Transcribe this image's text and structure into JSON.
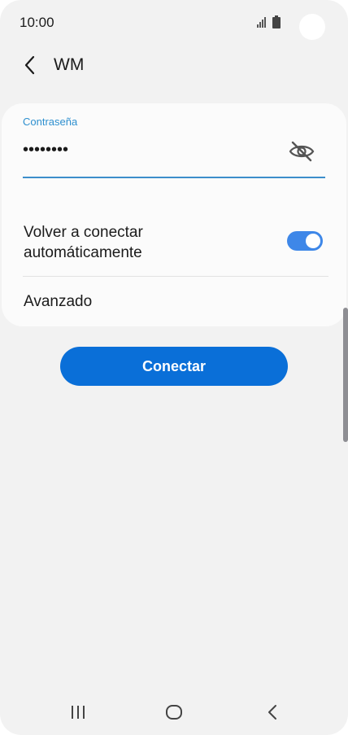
{
  "status_bar": {
    "time": "10:00",
    "icons": [
      "signal-icon",
      "battery-icon"
    ]
  },
  "header": {
    "back_icon": "chevron-left-icon",
    "title": "WM"
  },
  "form": {
    "password_label": "Contraseña",
    "password_value": "••••••••",
    "visibility_icon": "eye-off-icon",
    "reconnect_label": "Volver a conectar automáticamente",
    "reconnect_enabled": true,
    "advanced_label": "Avanzado"
  },
  "actions": {
    "connect_label": "Conectar"
  },
  "nav_bar": {
    "icons": [
      "recent-apps-icon",
      "home-icon",
      "back-icon"
    ]
  },
  "colors": {
    "accent": "#0a6fd8",
    "field_label": "#2d8fcf",
    "toggle_on": "#3e87e8",
    "background": "#f2f2f2",
    "card": "#fbfbfb"
  }
}
